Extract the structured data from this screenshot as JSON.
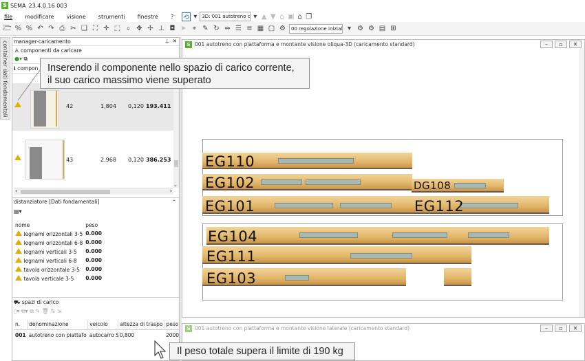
{
  "app": {
    "name": "SEMA",
    "version": "23.4.0.16 003"
  },
  "menu": [
    "file",
    "modificare",
    "visione",
    "strumenti",
    "finestre",
    "?"
  ],
  "toolbar": {
    "view_combo": "3D: 001 autotreno cor",
    "regulation_combo": "00 regolazione iniziale"
  },
  "sidetab": {
    "label": "container dati fondamentali"
  },
  "manager": {
    "title": "manager-caricamento",
    "components_header": "componenti da caricare",
    "column_fragment": "compon",
    "rows": [
      {
        "n": "42",
        "a": "1,804",
        "b": "0,120",
        "c": "193.411"
      },
      {
        "n": "43",
        "a": "2,968",
        "b": "0,120",
        "c": "386.253"
      }
    ]
  },
  "spacers": {
    "title": "distanziatore [Dati fondamentali]",
    "col_name": "nome",
    "col_weight": "peso",
    "rows": [
      {
        "name": "legnami orizzontali 3-5",
        "weight": "0.000"
      },
      {
        "name": "legnami orizzontali 6-8",
        "weight": "0.000"
      },
      {
        "name": "legnami verticali 3-5",
        "weight": "0.000"
      },
      {
        "name": "legnami verticali 6-8",
        "weight": "0.000"
      },
      {
        "name": "tavola orizzontale 3-5",
        "weight": "0.000"
      },
      {
        "name": "tavola verticale 3-5",
        "weight": "0.000"
      }
    ]
  },
  "load_spaces": {
    "title": "spazi di carico",
    "headers": [
      "n.",
      "denominazione",
      "veicolo",
      "altezza di traspo",
      "peso"
    ],
    "row": {
      "n": "001",
      "name": "autotreno con piattafo",
      "vehicle": "autocarro SE",
      "height": "0,800",
      "weight": "2000,000"
    }
  },
  "window3d": {
    "title": "001 autotreno con piattaforma e montante visione oliqua-3D (caricamento standard)"
  },
  "window_side": {
    "title": "001 autotreno con piattaforma e montante visione laterale (caricamento standard)"
  },
  "beams": {
    "eg110": "EG110",
    "eg102": "EG102",
    "dg108": "DG108",
    "eg101": "EG101",
    "eg112": "EG112",
    "eg104": "EG104",
    "eg111": "EG111",
    "eg103": "EG103"
  },
  "tooltips": {
    "top_line1": "Inserendo il componente nello spazio di carico corrente,",
    "top_line2": "il suo carico massimo viene superato",
    "bottom": "Il peso totale supera il limite di 190 kg"
  },
  "colors": {
    "brand": "#5bb32a",
    "warning": "#e0b000",
    "timber": "#e2b66a"
  }
}
